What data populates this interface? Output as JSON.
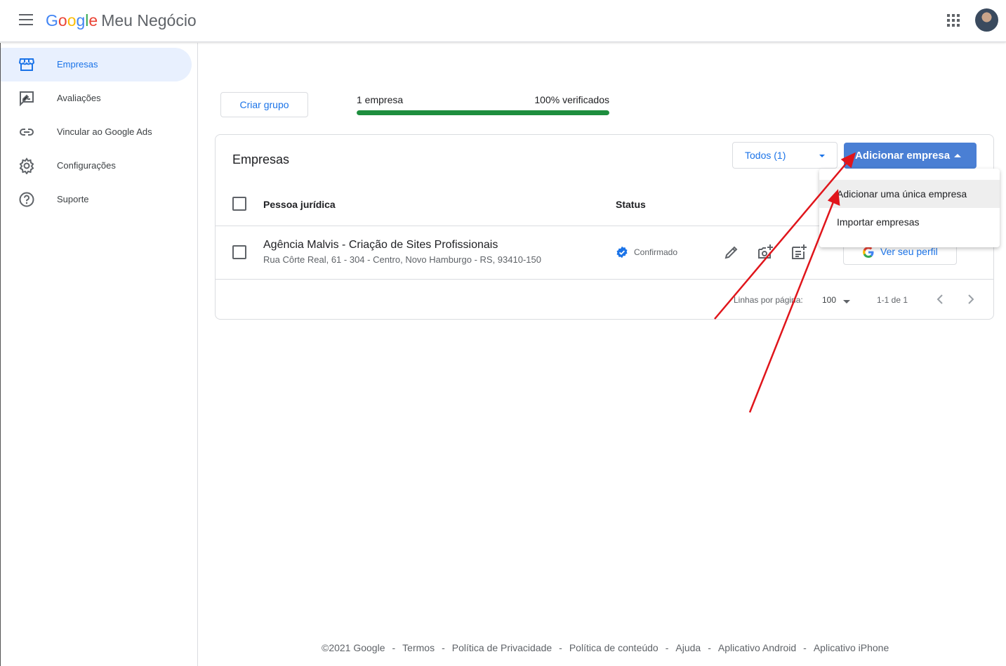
{
  "header": {
    "logo_google": [
      "G",
      "o",
      "o",
      "g",
      "l",
      "e"
    ],
    "product_name": "Meu Negócio"
  },
  "sidebar": {
    "items": [
      {
        "label": "Empresas",
        "icon": "storefront-icon",
        "active": true
      },
      {
        "label": "Avaliações",
        "icon": "rate-review-icon",
        "active": false
      },
      {
        "label": "Vincular ao Google Ads",
        "icon": "link-icon",
        "active": false
      },
      {
        "label": "Configurações",
        "icon": "gear-icon",
        "active": false
      },
      {
        "label": "Suporte",
        "icon": "help-icon",
        "active": false
      }
    ]
  },
  "toolbar": {
    "create_group": "Criar grupo",
    "count_label": "1 empresa",
    "verified_label": "100% verificados",
    "verified_fraction": 1.0
  },
  "card": {
    "title": "Empresas",
    "filter_value": "Todos (1)",
    "add_button": "Adicionar empresa",
    "columns": [
      "Pessoa jurídica",
      "Status"
    ],
    "rows": [
      {
        "name": "Agência Malvis - Criação de Sites Profissionais",
        "address": "Rua Côrte Real, 61 - 304 - Centro, Novo Hamburgo - RS, 93410-150",
        "status": "Confirmado",
        "profile_button": "Ver seu perfil"
      }
    ],
    "pagination": {
      "rows_label": "Linhas por página:",
      "rows_value": "100",
      "range": "1-1 de 1"
    }
  },
  "menu": {
    "items": [
      "Adicionar uma única empresa",
      "Importar empresas"
    ]
  },
  "footer": {
    "copyright": "©2021 Google",
    "links": [
      "Termos",
      "Política de Privacidade",
      "Política de conteúdo",
      "Ajuda",
      "Aplicativo Android",
      "Aplicativo iPhone"
    ],
    "separator": "-"
  },
  "colors": {
    "accent": "#1a73e8",
    "primary_button": "#4a7fd4",
    "progress": "#1e8e3e",
    "annotation_arrow": "#e0151b"
  }
}
